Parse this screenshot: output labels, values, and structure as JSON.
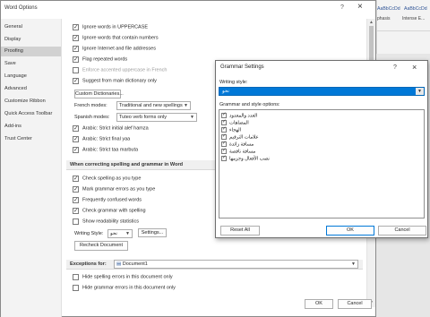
{
  "background_ribbon": {
    "styles": [
      "AaBbCcDd",
      "AaBbCcDd"
    ],
    "labels": [
      "phasis",
      "Intense E..."
    ]
  },
  "word_options": {
    "title": "Word Options",
    "help": "?",
    "close": "×",
    "sidebar": [
      {
        "label": "General",
        "active": false
      },
      {
        "label": "Display",
        "active": false
      },
      {
        "label": "Proofing",
        "active": true
      },
      {
        "label": "Save",
        "active": false
      },
      {
        "label": "Language",
        "active": false
      },
      {
        "label": "Advanced",
        "active": false
      },
      {
        "label": "Customize Ribbon",
        "active": false
      },
      {
        "label": "Quick Access Toolbar",
        "active": false
      },
      {
        "label": "Add-ins",
        "active": false
      },
      {
        "label": "Trust Center",
        "active": false
      }
    ],
    "options_top": [
      {
        "label": "Ignore words in UPPERCASE",
        "checked": true
      },
      {
        "label": "Ignore words that contain numbers",
        "checked": true
      },
      {
        "label": "Ignore Internet and file addresses",
        "checked": true
      },
      {
        "label": "Flag repeated words",
        "checked": true
      },
      {
        "label": "Enforce accented uppercase in French",
        "checked": false
      },
      {
        "label": "Suggest from main dictionary only",
        "checked": true
      }
    ],
    "custom_dictionaries_button": "Custom Dictionaries...",
    "french_modes_label": "French modes:",
    "french_modes_value": "Traditional and new spellings",
    "spanish_modes_label": "Spanish modes:",
    "spanish_modes_value": "Tuteo verb forms only",
    "options_arabic": [
      {
        "label": "Arabic: Strict initial alef hamza",
        "checked": true
      },
      {
        "label": "Arabic: Strict final yaa",
        "checked": true
      },
      {
        "label": "Arabic: Strict taa marbuta",
        "checked": true
      }
    ],
    "section_grammar": "When correcting spelling and grammar in Word",
    "options_grammar": [
      {
        "label": "Check spelling as you type",
        "checked": true
      },
      {
        "label": "Mark grammar errors as you type",
        "checked": true
      },
      {
        "label": "Frequently confused words",
        "checked": true
      },
      {
        "label": "Check grammar with spelling",
        "checked": true
      },
      {
        "label": "Show readability statistics",
        "checked": false
      }
    ],
    "writing_style_label": "Writing Style:",
    "writing_style_value": "نحو",
    "settings_button": "Settings...",
    "recheck_button": "Recheck Document",
    "exceptions_label": "Exceptions for:",
    "exceptions_value": "Document1",
    "options_exceptions": [
      {
        "label": "Hide spelling errors in this document only",
        "checked": false
      },
      {
        "label": "Hide grammar errors in this document only",
        "checked": false
      }
    ],
    "ok_button": "OK",
    "cancel_button": "Cancel"
  },
  "grammar_settings": {
    "title": "Grammar Settings",
    "help": "?",
    "close": "×",
    "writing_style_label": "Writing style:",
    "writing_style_value": "نحو",
    "options_label": "Grammar and style options:",
    "options": [
      {
        "label": "العدد والمعدود",
        "checked": true
      },
      {
        "label": "المضاهات",
        "checked": true
      },
      {
        "label": "الهجاء",
        "checked": true
      },
      {
        "label": "علامات الترقيم",
        "checked": true
      },
      {
        "label": "مسافة زائدة",
        "checked": true
      },
      {
        "label": "مسافة ناقصة",
        "checked": true
      },
      {
        "label": "نصب الأفعال وجزمها",
        "checked": true
      }
    ],
    "reset_button": "Reset All",
    "ok_button": "OK",
    "cancel_button": "Cancel"
  }
}
